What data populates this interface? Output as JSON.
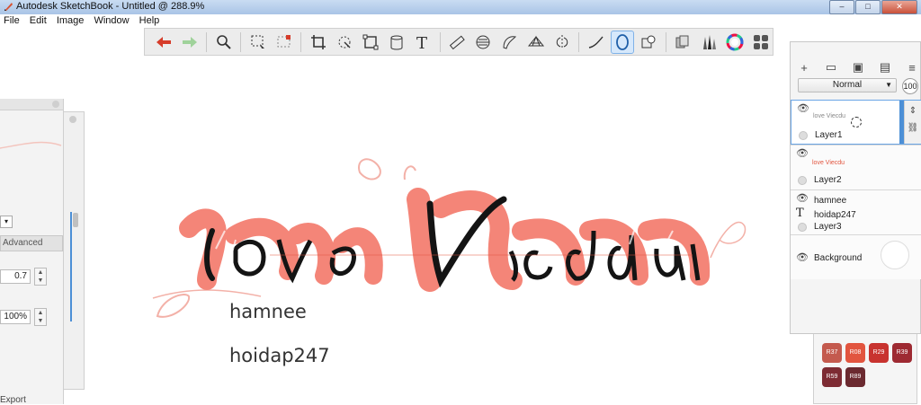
{
  "window": {
    "title": "Autodesk SketchBook - Untitled @ 288.9%",
    "buttons": [
      "–",
      "□",
      "✕"
    ]
  },
  "menu": [
    "File",
    "Edit",
    "Image",
    "Window",
    "Help"
  ],
  "toolbar": {
    "icons": [
      "undo-arrow-icon",
      "redo-arrow-icon",
      "zoom-magnifier-icon",
      "lasso-select-icon",
      "select-rect-icon",
      "crop-icon",
      "transform-icon",
      "distort-icon",
      "bucket-icon",
      "text-icon",
      "ruler-icon",
      "ellipse-guide-icon",
      "french-curve-icon",
      "perspective-icon",
      "symmetry-icon",
      "steady-stroke-icon",
      "ellipse-tool-icon",
      "shapes-icon",
      "copic-library-icon",
      "brush-library-icon",
      "color-wheel-icon",
      "swatches-icon"
    ],
    "active": "ellipse-tool-icon"
  },
  "left_panel": {
    "field1_value": "0.7",
    "field2_value": "100%",
    "tab_label": "Advanced",
    "footer_label": "Export"
  },
  "canvas_text": {
    "title_art": "love Viecdu",
    "line1": "hamnee",
    "line2": "hoidap247"
  },
  "layers": {
    "blend_mode": "Normal",
    "opacity": "100",
    "items": [
      {
        "name": "Layer1",
        "thumb": "love Viecdu"
      },
      {
        "name": "Layer2",
        "thumb": "love Viecdu"
      },
      {
        "name": "Layer3",
        "texts": [
          "hamnee",
          "hoidap247"
        ]
      },
      {
        "name": "Background"
      }
    ]
  },
  "swatches": [
    {
      "label": "R37",
      "color": "#c45a4e"
    },
    {
      "label": "R08",
      "color": "#e2553f"
    },
    {
      "label": "R29",
      "color": "#c8332f"
    },
    {
      "label": "R39",
      "color": "#9e2a32"
    },
    {
      "label": "R59",
      "color": "#7d2b33"
    },
    {
      "label": "R89",
      "color": "#6b2a30"
    }
  ]
}
